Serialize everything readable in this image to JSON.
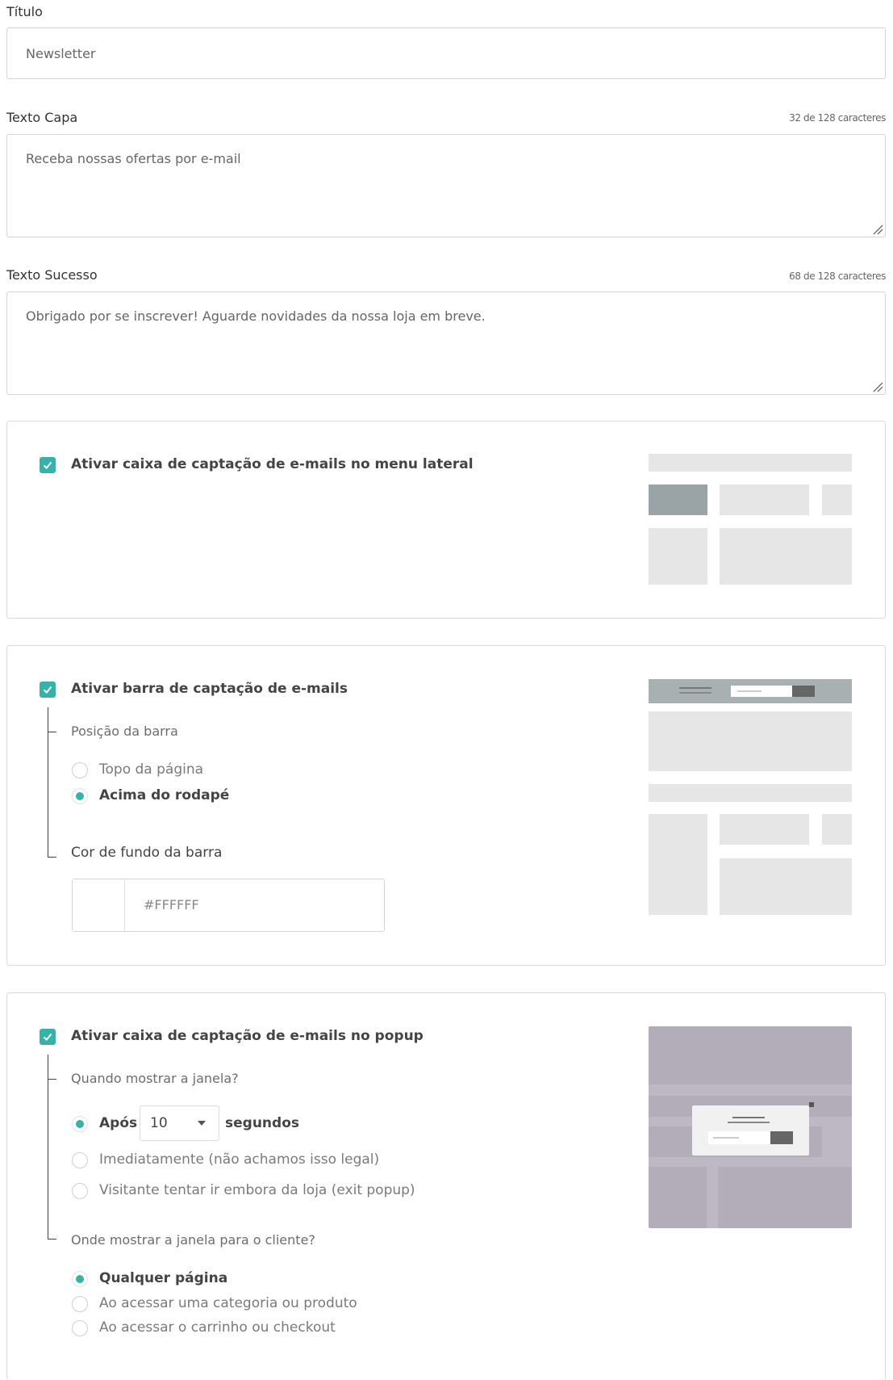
{
  "titulo": {
    "label": "Título",
    "value": "Newsletter"
  },
  "texto_capa": {
    "label": "Texto Capa",
    "counter": "32 de 128 caracteres",
    "value": "Receba nossas ofertas por e-mail"
  },
  "texto_sucesso": {
    "label": "Texto Sucesso",
    "counter": "68 de 128 caracteres",
    "value": "Obrigado por se inscrever! Aguarde novidades da nossa loja em breve."
  },
  "menu_lateral": {
    "checkbox_label": "Ativar caixa de captação de e-mails no menu lateral",
    "checked": true
  },
  "barra": {
    "checkbox_label": "Ativar barra de captação de e-mails",
    "checked": true,
    "position_label": "Posição da barra",
    "options": [
      "Topo da página",
      "Acima do rodapé"
    ],
    "selected": "Acima do rodapé",
    "color_label": "Cor de fundo da barra",
    "color_value": "#FFFFFF"
  },
  "popup": {
    "checkbox_label": "Ativar caixa de captação de e-mails no popup",
    "checked": true,
    "when_label": "Quando mostrar a janela?",
    "after_label": "Após",
    "after_value": "10",
    "seconds_label": "segundos",
    "when_options": [
      "Imediatamente (não achamos isso legal)",
      "Visitante tentar ir embora da loja (exit popup)"
    ],
    "where_label": "Onde mostrar a janela para o cliente?",
    "where_options": [
      "Qualquer página",
      "Ao acessar uma categoria ou produto",
      "Ao acessar o carrinho ou checkout"
    ],
    "where_selected": "Qualquer página"
  },
  "colors": {
    "accent": "#36b2a8",
    "border": "#d5d5d5",
    "placeholder": "#e6e6e6"
  }
}
